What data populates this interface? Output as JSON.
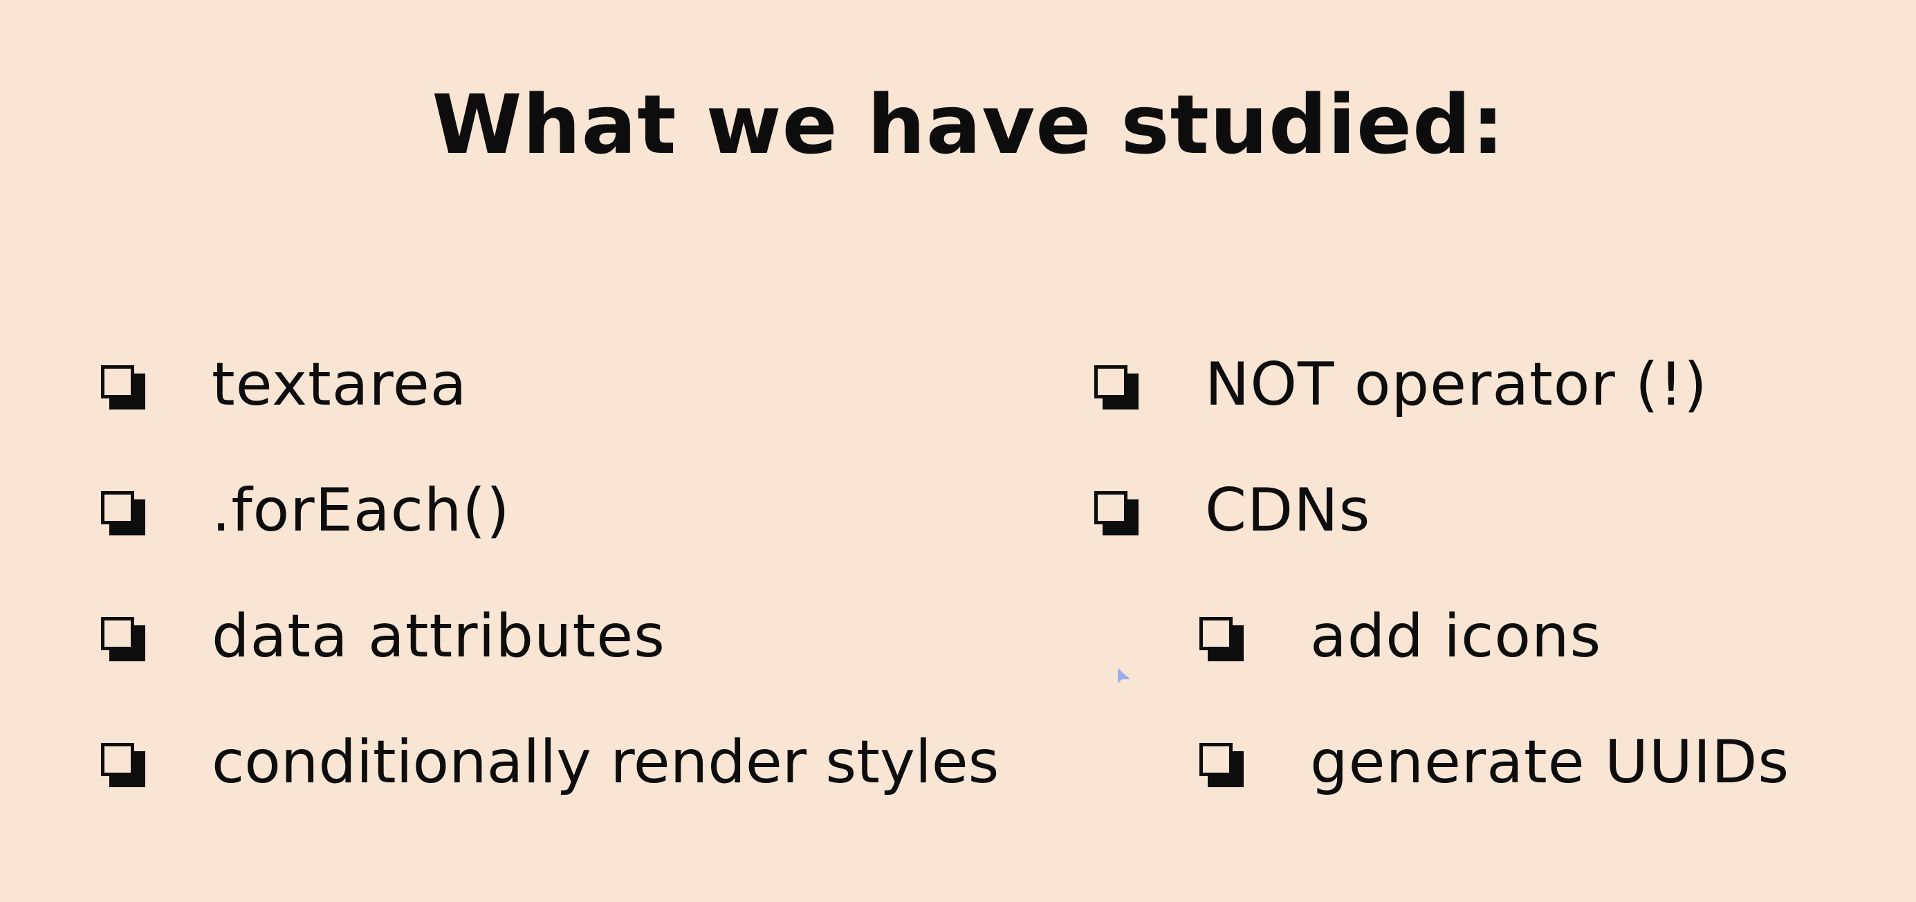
{
  "slide": {
    "title": "What we have studied:",
    "left_items": [
      {
        "label": "textarea"
      },
      {
        "label": ".forEach()"
      },
      {
        "label": "data attributes"
      },
      {
        "label": "conditionally render styles"
      }
    ],
    "right_items": [
      {
        "label": "NOT operator (!)"
      },
      {
        "label": "CDNs"
      }
    ],
    "right_subitems": [
      {
        "label": "add icons"
      },
      {
        "label": "generate UUIDs"
      }
    ]
  },
  "icons": {
    "bullet": "checkbox-icon",
    "cursor": "mouse-pointer-icon"
  },
  "colors": {
    "background": "#f9e5d4",
    "text": "#0d0d0d",
    "cursor": "#8ea6f5"
  }
}
